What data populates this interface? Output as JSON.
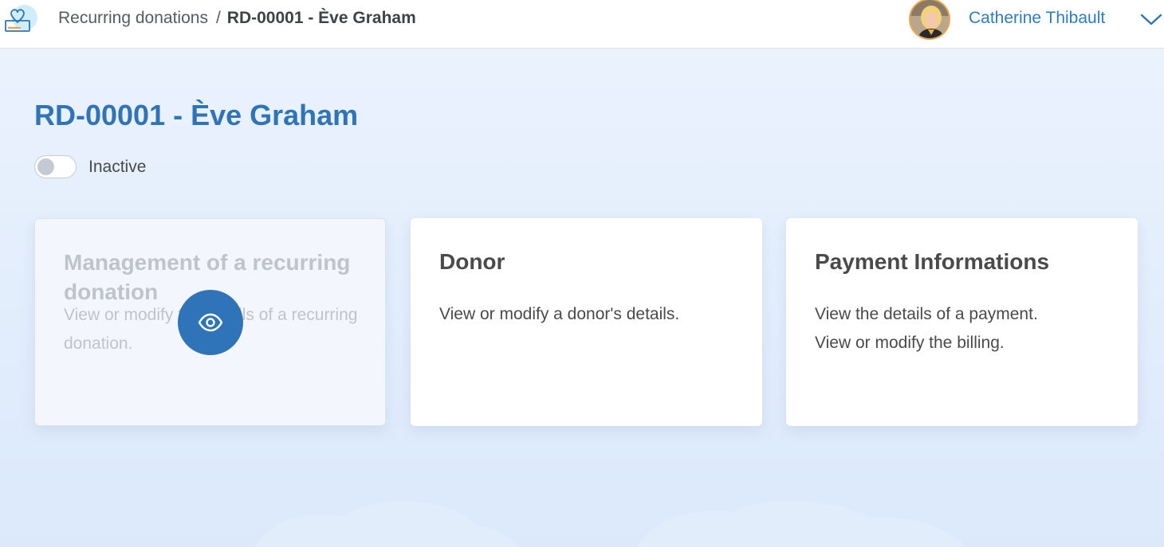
{
  "breadcrumb": {
    "parent": "Recurring donations",
    "separator": "/",
    "current": "RD-00001 - Ève Graham"
  },
  "user": {
    "name": "Catherine Thibault"
  },
  "page": {
    "title": "RD-00001 - Ève Graham",
    "status_label": "Inactive",
    "status_active": false
  },
  "cards": [
    {
      "title": "Management of a recurring donation",
      "description": "View or modify the details of a recurring donation.",
      "hovered": true
    },
    {
      "title": "Donor",
      "description": "View or modify a donor's details."
    },
    {
      "title": "Payment Informations",
      "description_lines": [
        "View the details of a payment.",
        "View or modify the billing."
      ]
    }
  ],
  "colors": {
    "accent": "#2f74b8",
    "link": "#2f7bbf",
    "background": "#e6f0fc",
    "card": "#ffffff",
    "text": "#4a4a4a",
    "muted_text": "#bfc4cb"
  },
  "icons": {
    "logo": "heart-hand-logo-icon",
    "view": "eye-icon",
    "user_menu": "chevron-down-icon"
  }
}
